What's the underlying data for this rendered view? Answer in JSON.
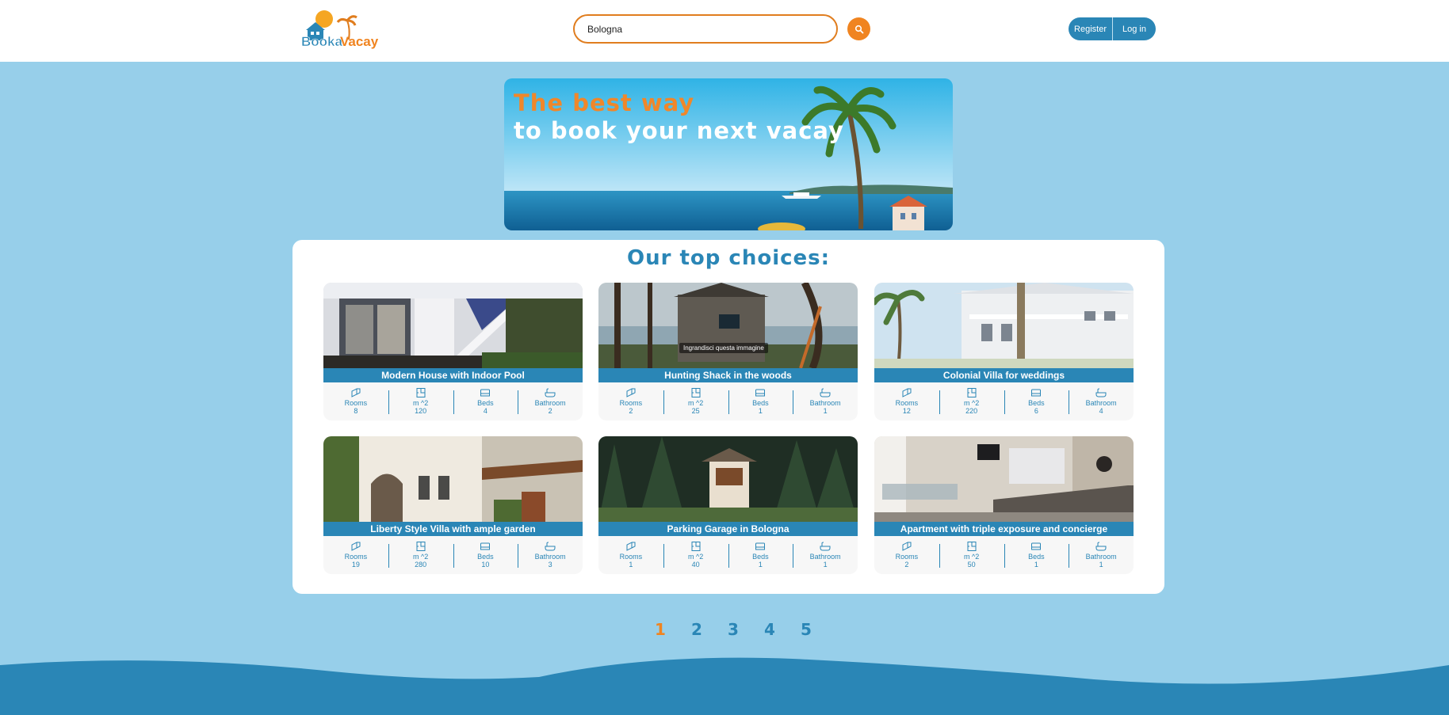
{
  "header": {
    "logo_text_1": "Booka",
    "logo_text_2": "Vacay",
    "search": {
      "value": "Bologna"
    },
    "register_label": "Register",
    "login_label": "Log in"
  },
  "hero": {
    "line1": "The best way",
    "line2": "to book your next vacay"
  },
  "choices": {
    "title": "Our top choices:",
    "stat_labels": {
      "rooms": "Rooms",
      "area": "m ^2",
      "beds": "Beds",
      "bathroom": "Bathroom"
    },
    "image_tooltip": "Ingrandisci questa immagine",
    "listings": [
      {
        "title": "Modern House with Indoor Pool",
        "rooms": "8",
        "area": "120",
        "beds": "4",
        "bathroom": "2"
      },
      {
        "title": "Hunting Shack in the woods",
        "rooms": "2",
        "area": "25",
        "beds": "1",
        "bathroom": "1"
      },
      {
        "title": "Colonial Villa for weddings",
        "rooms": "12",
        "area": "220",
        "beds": "6",
        "bathroom": "4"
      },
      {
        "title": "Liberty Style Villa with ample garden",
        "rooms": "19",
        "area": "280",
        "beds": "10",
        "bathroom": "3"
      },
      {
        "title": "Parking Garage in Bologna",
        "rooms": "1",
        "area": "40",
        "beds": "1",
        "bathroom": "1"
      },
      {
        "title": "Apartment with triple exposure and concierge",
        "rooms": "2",
        "area": "50",
        "beds": "1",
        "bathroom": "1"
      }
    ]
  },
  "pagination": {
    "pages": [
      "1",
      "2",
      "3",
      "4",
      "5"
    ],
    "current": "1"
  },
  "colors": {
    "primary": "#2a86b6",
    "accent": "#f08420",
    "background": "#97cfea"
  }
}
